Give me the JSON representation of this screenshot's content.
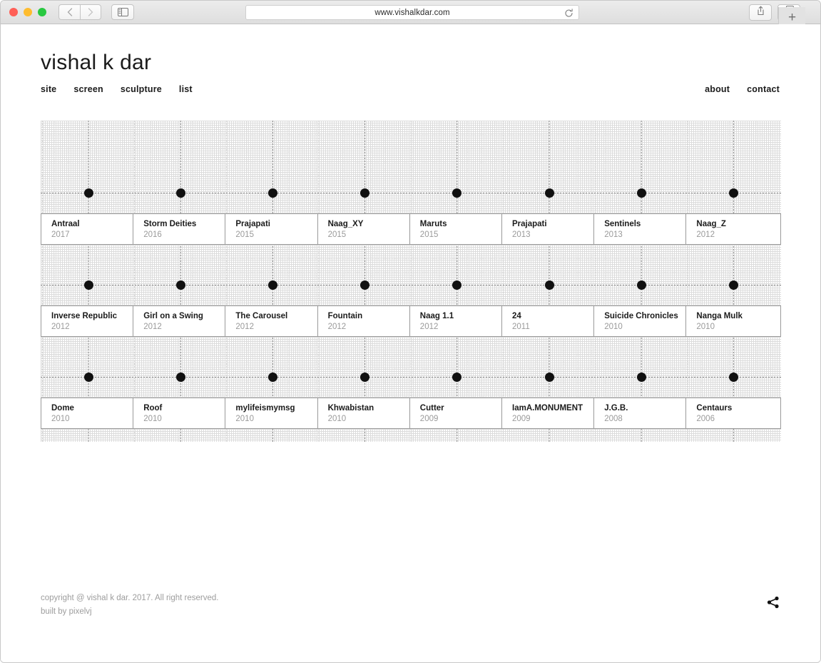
{
  "browser": {
    "url": "www.vishalkdar.com",
    "traffic_lights": [
      "close-red",
      "minimize-yellow",
      "maximize-green"
    ],
    "back_label": "‹",
    "forward_label": "›",
    "sidebar_icon": "sidebar-icon",
    "reload_icon": "reload-icon",
    "share_icon": "share-icon",
    "tabs_icon": "tab-overview-icon",
    "new_tab_label": "+"
  },
  "site": {
    "title": "vishal k dar",
    "nav_left": [
      {
        "label": "site"
      },
      {
        "label": "screen"
      },
      {
        "label": "sculpture"
      },
      {
        "label": "list"
      }
    ],
    "nav_right": [
      {
        "label": "about"
      },
      {
        "label": "contact"
      }
    ]
  },
  "timeline": {
    "rows": [
      [
        {
          "title": "Antraal",
          "year": "2017"
        },
        {
          "title": "Storm Deities",
          "year": "2016"
        },
        {
          "title": "Prajapati",
          "year": "2015"
        },
        {
          "title": "Naag_XY",
          "year": "2015"
        },
        {
          "title": "Maruts",
          "year": "2015"
        },
        {
          "title": "Prajapati",
          "year": "2013"
        },
        {
          "title": "Sentinels",
          "year": "2013"
        },
        {
          "title": "Naag_Z",
          "year": "2012"
        }
      ],
      [
        {
          "title": "Inverse Republic",
          "year": "2012"
        },
        {
          "title": "Girl on a Swing",
          "year": "2012"
        },
        {
          "title": "The Carousel",
          "year": "2012"
        },
        {
          "title": "Fountain",
          "year": "2012"
        },
        {
          "title": "Naag 1.1",
          "year": "2012"
        },
        {
          "title": "24",
          "year": "2011"
        },
        {
          "title": "Suicide Chronicles",
          "year": "2010"
        },
        {
          "title": "Nanga Mulk",
          "year": "2010"
        }
      ],
      [
        {
          "title": "Dome",
          "year": "2010"
        },
        {
          "title": "Roof",
          "year": "2010"
        },
        {
          "title": "mylifeismymsg",
          "year": "2010"
        },
        {
          "title": "Khwabistan",
          "year": "2010"
        },
        {
          "title": "Cutter",
          "year": "2009"
        },
        {
          "title": "IamA.MONUMENT",
          "year": "2009"
        },
        {
          "title": "J.G.B.",
          "year": "2008"
        },
        {
          "title": "Centaurs",
          "year": "2006"
        }
      ]
    ]
  },
  "footer": {
    "copyright": "copyright @ vishal k dar. 2017. All right reserved.",
    "builtby": "built by pixelvj",
    "share_icon": "share-icon"
  },
  "colors": {
    "text": "#1b1b1b",
    "muted": "#9a9a9a",
    "grid": "#dcdcdc",
    "axis": "#8a8a8a",
    "node": "#111111"
  }
}
